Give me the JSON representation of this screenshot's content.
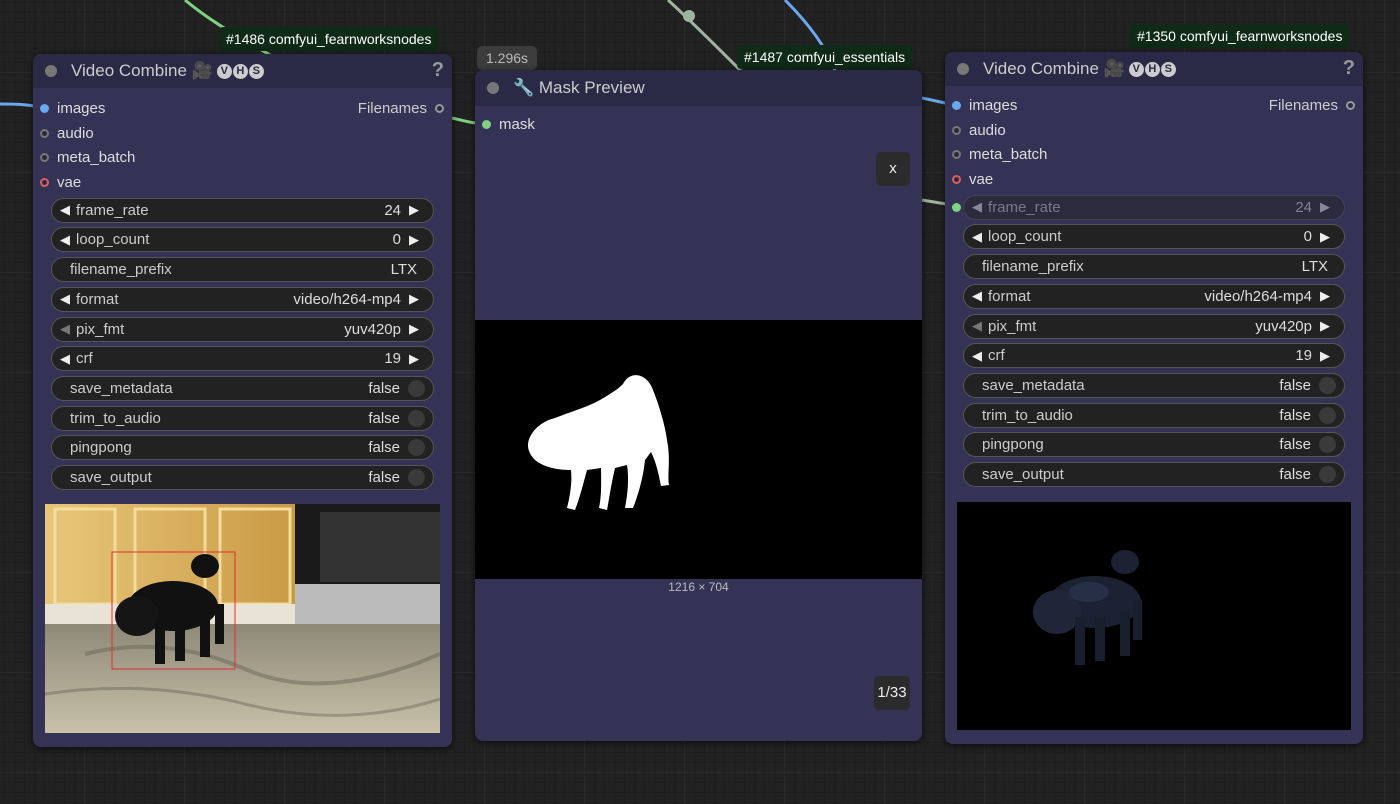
{
  "badges": {
    "left": "#1486 comfyui_fearnworksnodes",
    "middle": "#1487 comfyui_essentials",
    "right": "#1350 comfyui_fearnworksnodes"
  },
  "timing": "1.296s",
  "video_combine_left": {
    "title": "Video Combine 🎥",
    "vhs_letters": [
      "V",
      "H",
      "S"
    ],
    "help_label": "?",
    "inputs": [
      "images",
      "audio",
      "meta_batch",
      "vae"
    ],
    "output": "Filenames",
    "widgets": {
      "frame_rate": {
        "label": "frame_rate",
        "value": "24"
      },
      "loop_count": {
        "label": "loop_count",
        "value": "0"
      },
      "filename_prefix": {
        "label": "filename_prefix",
        "value": "LTX"
      },
      "format": {
        "label": "format",
        "value": "video/h264-mp4"
      },
      "pix_fmt": {
        "label": "pix_fmt",
        "value": "yuv420p"
      },
      "crf": {
        "label": "crf",
        "value": "19"
      },
      "save_metadata": {
        "label": "save_metadata",
        "value": "false"
      },
      "trim_to_audio": {
        "label": "trim_to_audio",
        "value": "false"
      },
      "pingpong": {
        "label": "pingpong",
        "value": "false"
      },
      "save_output": {
        "label": "save_output",
        "value": "false"
      }
    }
  },
  "mask_preview": {
    "title": "🔧 Mask Preview",
    "input": "mask",
    "close_label": "x",
    "dimensions": "1216 × 704",
    "counter": "1/33"
  },
  "video_combine_right": {
    "title": "Video Combine 🎥",
    "vhs_letters": [
      "V",
      "H",
      "S"
    ],
    "help_label": "?",
    "inputs": [
      "images",
      "audio",
      "meta_batch",
      "vae"
    ],
    "output": "Filenames",
    "widgets": {
      "frame_rate": {
        "label": "frame_rate",
        "value": "24"
      },
      "loop_count": {
        "label": "loop_count",
        "value": "0"
      },
      "filename_prefix": {
        "label": "filename_prefix",
        "value": "LTX"
      },
      "format": {
        "label": "format",
        "value": "video/h264-mp4"
      },
      "pix_fmt": {
        "label": "pix_fmt",
        "value": "yuv420p"
      },
      "crf": {
        "label": "crf",
        "value": "19"
      },
      "save_metadata": {
        "label": "save_metadata",
        "value": "false"
      },
      "trim_to_audio": {
        "label": "trim_to_audio",
        "value": "false"
      },
      "pingpong": {
        "label": "pingpong",
        "value": "false"
      },
      "save_output": {
        "label": "save_output",
        "value": "false"
      }
    }
  },
  "colors": {
    "canvas": "#222222",
    "node_body": "#353355",
    "node_header": "#2a2946",
    "wire_image": "#6aa8f0",
    "wire_mask": "#7fd27f",
    "wire_grey": "#a0b4a0",
    "badge_bg": "#0f2a17"
  }
}
